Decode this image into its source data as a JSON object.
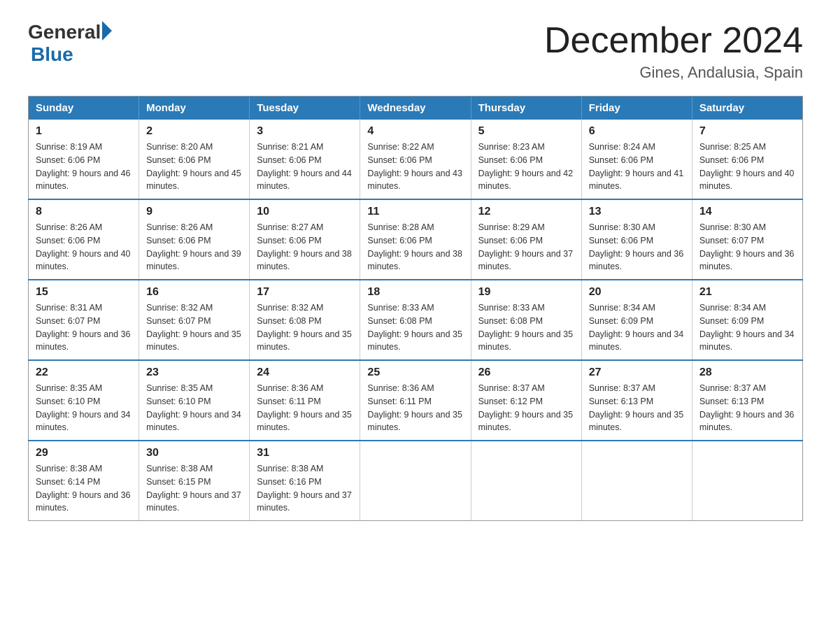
{
  "header": {
    "logo": {
      "general": "General",
      "blue": "Blue",
      "arrow": "▶"
    },
    "title": "December 2024",
    "location": "Gines, Andalusia, Spain"
  },
  "days_of_week": [
    "Sunday",
    "Monday",
    "Tuesday",
    "Wednesday",
    "Thursday",
    "Friday",
    "Saturday"
  ],
  "weeks": [
    [
      {
        "day": "1",
        "sunrise": "8:19 AM",
        "sunset": "6:06 PM",
        "daylight": "9 hours and 46 minutes."
      },
      {
        "day": "2",
        "sunrise": "8:20 AM",
        "sunset": "6:06 PM",
        "daylight": "9 hours and 45 minutes."
      },
      {
        "day": "3",
        "sunrise": "8:21 AM",
        "sunset": "6:06 PM",
        "daylight": "9 hours and 44 minutes."
      },
      {
        "day": "4",
        "sunrise": "8:22 AM",
        "sunset": "6:06 PM",
        "daylight": "9 hours and 43 minutes."
      },
      {
        "day": "5",
        "sunrise": "8:23 AM",
        "sunset": "6:06 PM",
        "daylight": "9 hours and 42 minutes."
      },
      {
        "day": "6",
        "sunrise": "8:24 AM",
        "sunset": "6:06 PM",
        "daylight": "9 hours and 41 minutes."
      },
      {
        "day": "7",
        "sunrise": "8:25 AM",
        "sunset": "6:06 PM",
        "daylight": "9 hours and 40 minutes."
      }
    ],
    [
      {
        "day": "8",
        "sunrise": "8:26 AM",
        "sunset": "6:06 PM",
        "daylight": "9 hours and 40 minutes."
      },
      {
        "day": "9",
        "sunrise": "8:26 AM",
        "sunset": "6:06 PM",
        "daylight": "9 hours and 39 minutes."
      },
      {
        "day": "10",
        "sunrise": "8:27 AM",
        "sunset": "6:06 PM",
        "daylight": "9 hours and 38 minutes."
      },
      {
        "day": "11",
        "sunrise": "8:28 AM",
        "sunset": "6:06 PM",
        "daylight": "9 hours and 38 minutes."
      },
      {
        "day": "12",
        "sunrise": "8:29 AM",
        "sunset": "6:06 PM",
        "daylight": "9 hours and 37 minutes."
      },
      {
        "day": "13",
        "sunrise": "8:30 AM",
        "sunset": "6:06 PM",
        "daylight": "9 hours and 36 minutes."
      },
      {
        "day": "14",
        "sunrise": "8:30 AM",
        "sunset": "6:07 PM",
        "daylight": "9 hours and 36 minutes."
      }
    ],
    [
      {
        "day": "15",
        "sunrise": "8:31 AM",
        "sunset": "6:07 PM",
        "daylight": "9 hours and 36 minutes."
      },
      {
        "day": "16",
        "sunrise": "8:32 AM",
        "sunset": "6:07 PM",
        "daylight": "9 hours and 35 minutes."
      },
      {
        "day": "17",
        "sunrise": "8:32 AM",
        "sunset": "6:08 PM",
        "daylight": "9 hours and 35 minutes."
      },
      {
        "day": "18",
        "sunrise": "8:33 AM",
        "sunset": "6:08 PM",
        "daylight": "9 hours and 35 minutes."
      },
      {
        "day": "19",
        "sunrise": "8:33 AM",
        "sunset": "6:08 PM",
        "daylight": "9 hours and 35 minutes."
      },
      {
        "day": "20",
        "sunrise": "8:34 AM",
        "sunset": "6:09 PM",
        "daylight": "9 hours and 34 minutes."
      },
      {
        "day": "21",
        "sunrise": "8:34 AM",
        "sunset": "6:09 PM",
        "daylight": "9 hours and 34 minutes."
      }
    ],
    [
      {
        "day": "22",
        "sunrise": "8:35 AM",
        "sunset": "6:10 PM",
        "daylight": "9 hours and 34 minutes."
      },
      {
        "day": "23",
        "sunrise": "8:35 AM",
        "sunset": "6:10 PM",
        "daylight": "9 hours and 34 minutes."
      },
      {
        "day": "24",
        "sunrise": "8:36 AM",
        "sunset": "6:11 PM",
        "daylight": "9 hours and 35 minutes."
      },
      {
        "day": "25",
        "sunrise": "8:36 AM",
        "sunset": "6:11 PM",
        "daylight": "9 hours and 35 minutes."
      },
      {
        "day": "26",
        "sunrise": "8:37 AM",
        "sunset": "6:12 PM",
        "daylight": "9 hours and 35 minutes."
      },
      {
        "day": "27",
        "sunrise": "8:37 AM",
        "sunset": "6:13 PM",
        "daylight": "9 hours and 35 minutes."
      },
      {
        "day": "28",
        "sunrise": "8:37 AM",
        "sunset": "6:13 PM",
        "daylight": "9 hours and 36 minutes."
      }
    ],
    [
      {
        "day": "29",
        "sunrise": "8:38 AM",
        "sunset": "6:14 PM",
        "daylight": "9 hours and 36 minutes."
      },
      {
        "day": "30",
        "sunrise": "8:38 AM",
        "sunset": "6:15 PM",
        "daylight": "9 hours and 37 minutes."
      },
      {
        "day": "31",
        "sunrise": "8:38 AM",
        "sunset": "6:16 PM",
        "daylight": "9 hours and 37 minutes."
      },
      null,
      null,
      null,
      null
    ]
  ]
}
